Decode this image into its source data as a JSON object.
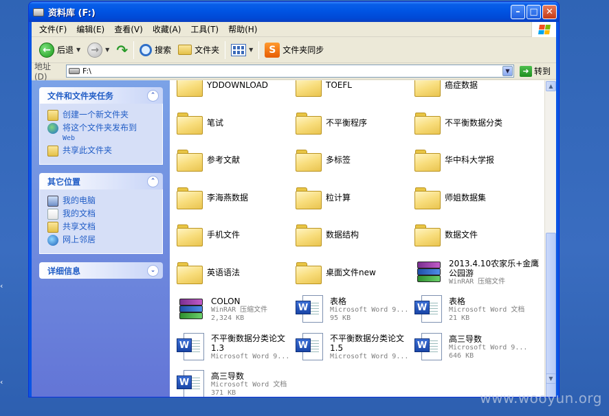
{
  "window": {
    "title": "资料库 (F:)"
  },
  "menu": [
    "文件(F)",
    "编辑(E)",
    "查看(V)",
    "收藏(A)",
    "工具(T)",
    "帮助(H)"
  ],
  "toolbar": {
    "back": "后退",
    "search": "搜索",
    "folders": "文件夹",
    "sync": "文件夹同步"
  },
  "address": {
    "label": "地址(D)",
    "value": "F:\\",
    "go": "转到"
  },
  "sidebar": {
    "tasks": {
      "title": "文件和文件夹任务",
      "items": [
        "创建一个新文件夹",
        "将这个文件夹发布到",
        "Web",
        "共享此文件夹"
      ]
    },
    "places": {
      "title": "其它位置",
      "items": [
        "我的电脑",
        "我的文档",
        "共享文档",
        "网上邻居"
      ]
    },
    "details": {
      "title": "详细信息"
    }
  },
  "files": [
    {
      "name": "YDDOWNLOAD",
      "type": "folder"
    },
    {
      "name": "TOEFL",
      "type": "folder"
    },
    {
      "name": "癌症数据",
      "type": "folder"
    },
    {
      "name": "笔试",
      "type": "folder"
    },
    {
      "name": "不平衡程序",
      "type": "folder"
    },
    {
      "name": "不平衡数据分类",
      "type": "folder"
    },
    {
      "name": "参考文献",
      "type": "folder"
    },
    {
      "name": "多标签",
      "type": "folder"
    },
    {
      "name": "华中科大学报",
      "type": "folder"
    },
    {
      "name": "李海燕数据",
      "type": "folder"
    },
    {
      "name": "粒计算",
      "type": "folder"
    },
    {
      "name": "师姐数据集",
      "type": "folder"
    },
    {
      "name": "手机文件",
      "type": "folder"
    },
    {
      "name": "数据结构",
      "type": "folder"
    },
    {
      "name": "数据文件",
      "type": "folder"
    },
    {
      "name": "英语语法",
      "type": "folder"
    },
    {
      "name": "桌面文件new",
      "type": "folder"
    },
    {
      "name": "2013.4.10农家乐+金鹰公园游",
      "type": "rar",
      "line2": "WinRAR 压缩文件",
      "line3": ""
    },
    {
      "name": "COLON",
      "type": "rar",
      "line2": "WinRAR 压缩文件",
      "line3": "2,324 KB"
    },
    {
      "name": "表格",
      "type": "word",
      "line2": "Microsoft Word 9...",
      "line3": "95 KB"
    },
    {
      "name": "表格",
      "type": "word",
      "line2": "Microsoft Word 文档",
      "line3": "21 KB"
    },
    {
      "name": "不平衡数据分类论文1.3",
      "type": "word",
      "line2": "Microsoft Word 9...",
      "line3": ""
    },
    {
      "name": "不平衡数据分类论文1.5",
      "type": "word",
      "line2": "Microsoft Word 9...",
      "line3": ""
    },
    {
      "name": "高三导数",
      "type": "word",
      "line2": "Microsoft Word 9...",
      "line3": "646 KB"
    },
    {
      "name": "高三导数",
      "type": "word",
      "line2": "Microsoft Word 文档",
      "line3": "371 KB"
    }
  ],
  "watermark": "www.wooyun.org"
}
